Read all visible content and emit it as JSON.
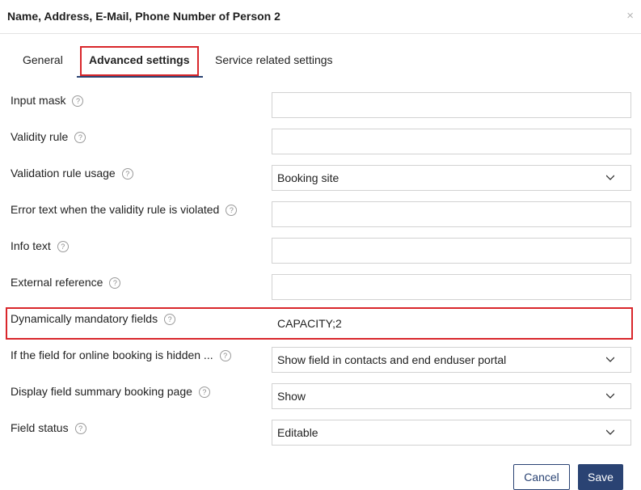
{
  "dialog": {
    "title": "Name, Address, E-Mail, Phone Number of Person 2",
    "close_glyph": "×"
  },
  "tabs": [
    {
      "label": "General"
    },
    {
      "label": "Advanced settings"
    },
    {
      "label": "Service related settings"
    }
  ],
  "help_glyph": "?",
  "rows": [
    {
      "label": "Input mask",
      "value": ""
    },
    {
      "label": "Validity rule",
      "value": ""
    },
    {
      "label": "Validation rule usage",
      "value": "Booking site"
    },
    {
      "label": "Error text when the validity rule is violated",
      "value": ""
    },
    {
      "label": "Info text",
      "value": ""
    },
    {
      "label": "External reference",
      "value": ""
    },
    {
      "label": "Dynamically mandatory fields",
      "value": "CAPACITY;2"
    },
    {
      "label": "If the field for online booking is hidden ...",
      "value": "Show field in contacts and end enduser portal"
    },
    {
      "label": "Display field summary booking page",
      "value": "Show"
    },
    {
      "label": "Field status",
      "value": "Editable"
    }
  ],
  "buttons": {
    "cancel": "Cancel",
    "save": "Save"
  },
  "colors": {
    "accent": "#2a4373",
    "highlight": "#d9262b"
  }
}
